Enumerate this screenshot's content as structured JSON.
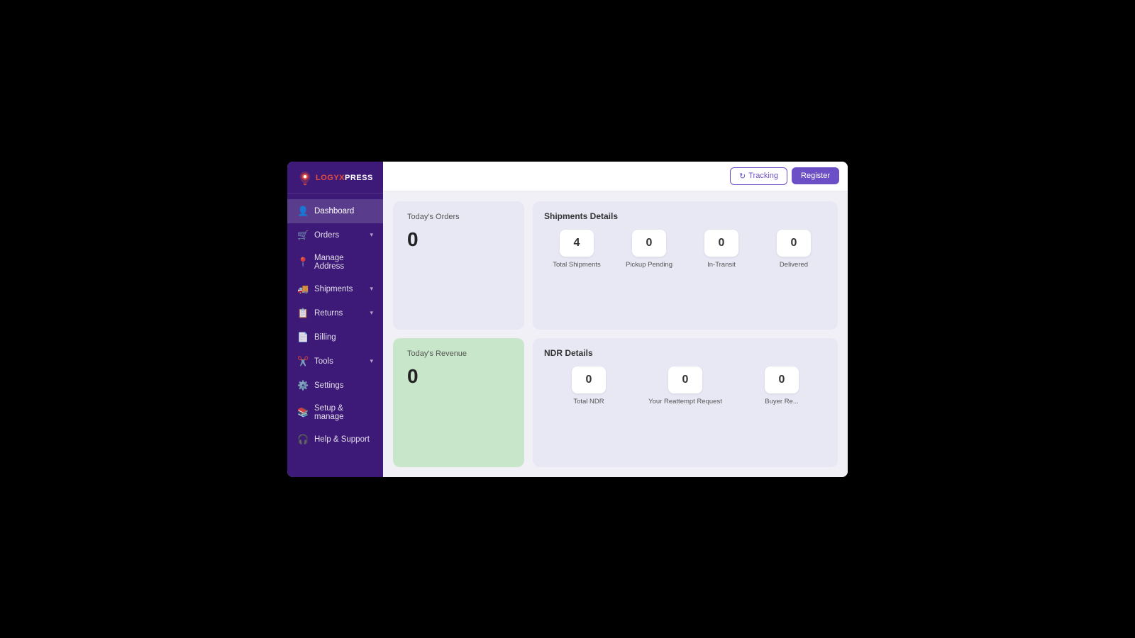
{
  "logo": {
    "text_logy": "LOGY",
    "text_xpress": "XPRESS"
  },
  "header": {
    "tracking_label": "Tracking",
    "register_label": "Register"
  },
  "sidebar": {
    "items": [
      {
        "id": "dashboard",
        "label": "Dashboard",
        "icon": "👤",
        "arrow": ""
      },
      {
        "id": "orders",
        "label": "Orders",
        "icon": "🛒",
        "arrow": "▾"
      },
      {
        "id": "manage-address",
        "label": "Manage Address",
        "icon": "📍",
        "arrow": ""
      },
      {
        "id": "shipments",
        "label": "Shipments",
        "icon": "🚚",
        "arrow": "▾"
      },
      {
        "id": "returns",
        "label": "Returns",
        "icon": "📋",
        "arrow": "▾"
      },
      {
        "id": "billing",
        "label": "Billing",
        "icon": "📄",
        "arrow": ""
      },
      {
        "id": "tools",
        "label": "Tools",
        "icon": "✂️",
        "arrow": "▾"
      },
      {
        "id": "settings",
        "label": "Settings",
        "icon": "⚙️",
        "arrow": ""
      },
      {
        "id": "setup-manage",
        "label": "Setup & manage",
        "icon": "📚",
        "arrow": ""
      },
      {
        "id": "help-support",
        "label": "Help & Support",
        "icon": "🎧",
        "arrow": ""
      }
    ]
  },
  "dashboard": {
    "today_orders": {
      "label": "Today's Orders",
      "value": "0"
    },
    "shipments_details": {
      "title": "Shipments Details",
      "stats": [
        {
          "id": "total",
          "value": "4",
          "label": "Total Shipments"
        },
        {
          "id": "pickup",
          "value": "0",
          "label": "Pickup Pending"
        },
        {
          "id": "transit",
          "value": "0",
          "label": "In-Transit"
        },
        {
          "id": "delivered",
          "value": "0",
          "label": "Delivered"
        }
      ]
    },
    "today_revenue": {
      "label": "Today's Revenue",
      "value": "0"
    },
    "ndr_details": {
      "title": "NDR Details",
      "stats": [
        {
          "id": "total-ndr",
          "value": "0",
          "label": "Total NDR"
        },
        {
          "id": "reattempt",
          "value": "0",
          "label": "Your Reattempt Request"
        },
        {
          "id": "buyer",
          "value": "0",
          "label": "Buyer Re..."
        }
      ]
    }
  }
}
